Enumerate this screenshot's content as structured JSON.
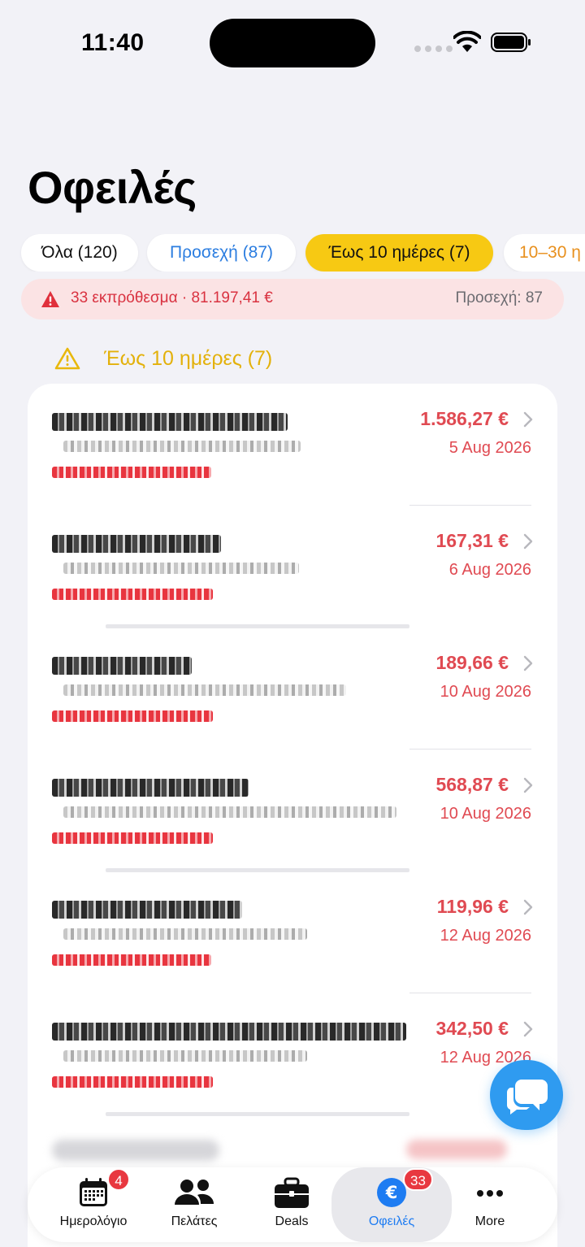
{
  "status_bar": {
    "time": "11:40"
  },
  "page": {
    "title": "Οφειλές"
  },
  "filters": [
    {
      "label": "Όλα (120)"
    },
    {
      "label": "Προσεχή (87)"
    },
    {
      "label": "Έως 10 ημέρες (7)"
    },
    {
      "label": "10–30 η"
    }
  ],
  "alert": {
    "text": "33 εκπρόθεσμα · 81.197,41 €",
    "right": "Προσεχή: 87"
  },
  "section": {
    "title": "Έως 10 ημέρες (7)"
  },
  "rows": [
    {
      "amount": "1.586,27 €",
      "due": "5 Aug 2026"
    },
    {
      "amount": "167,31 €",
      "due": "6 Aug 2026"
    },
    {
      "amount": "189,66 €",
      "due": "10 Aug 2026"
    },
    {
      "amount": "568,87 €",
      "due": "10 Aug 2026"
    },
    {
      "amount": "119,96 €",
      "due": "12 Aug 2026"
    },
    {
      "amount": "342,50 €",
      "due": "12 Aug 2026"
    }
  ],
  "tabs": [
    {
      "label": "Ημερολόγιο",
      "badge": "4"
    },
    {
      "label": "Πελάτες"
    },
    {
      "label": "Deals"
    },
    {
      "label": "Οφειλές",
      "badge": "33"
    },
    {
      "label": "More"
    }
  ],
  "colors": {
    "accent_blue": "#1e7cf2",
    "danger": "#e04a52",
    "warning": "#f7c913",
    "background": "#f2f2f7"
  }
}
